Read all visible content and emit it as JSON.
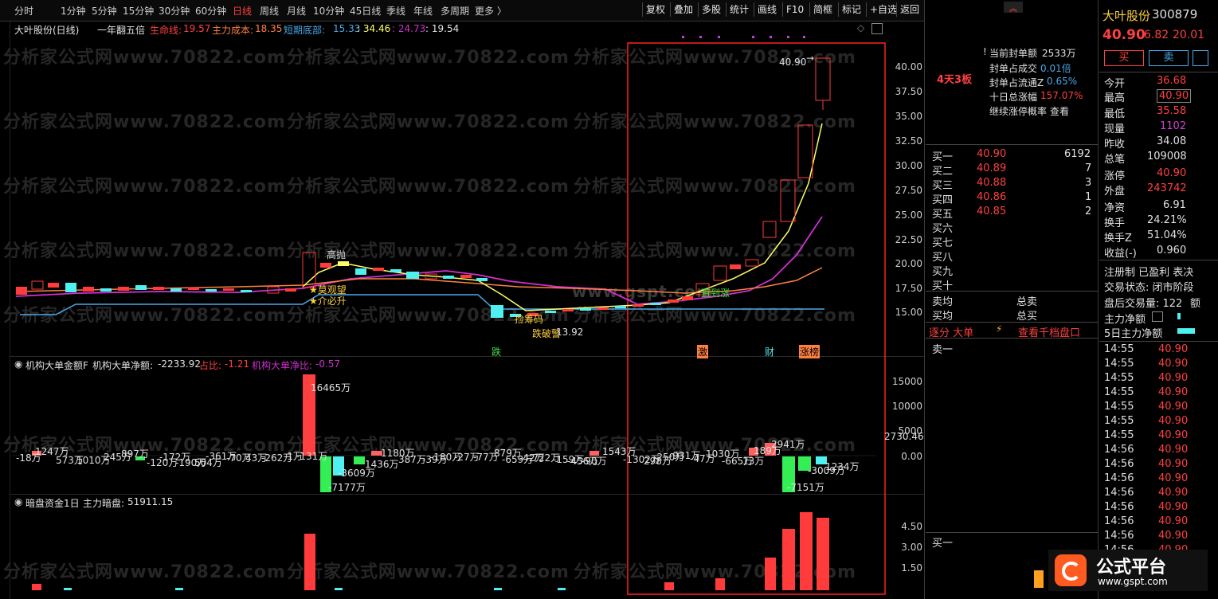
{
  "toolbar": {
    "periods": [
      "分时",
      "1分钟",
      "5分钟",
      "15分钟",
      "30分钟",
      "60分钟",
      "日线",
      "周线",
      "月线",
      "10分钟",
      "45日线",
      "季线",
      "年线",
      "多周期",
      "更多 〉"
    ],
    "active_period": "日线",
    "tools": [
      "复权",
      "叠加",
      "多股",
      "统计",
      "画线",
      "F10",
      "简框",
      "标记",
      "+自选",
      "返回"
    ]
  },
  "main_chart": {
    "stock_title": "大叶股份(日线)",
    "formula": "一年翻五倍",
    "line1_label": "生命线:",
    "line1_value": "19.57",
    "line2_label": "主力成本:",
    "line2_value": "18.35",
    "line3_label": "短期底部:",
    "line3_value": "15.33",
    "extra1": ": 34.46",
    "extra2": ": 24.73",
    "extra3": ": 19.54",
    "price_ticks": [
      "40.00",
      "37.50",
      "35.00",
      "32.50",
      "30.00",
      "27.50",
      "25.00",
      "22.50",
      "20.00",
      "17.50",
      "15.00"
    ],
    "max_label": "40.90",
    "min_label": "13.92",
    "annotations": {
      "gaopao": "高抛",
      "mohuwang": "★莫观望",
      "jiedisheng": "★介必升",
      "jiandi": "捡筹码",
      "diekan": "跌破警",
      "fanzhang": "直到涨"
    },
    "bottom_marks": {
      "die": "跌",
      "ji": "激",
      "cai": "财",
      "zhangting": "涨榜"
    },
    "colors": {
      "up": "#ff3b3b",
      "down": "#4ef0f0",
      "yellow": "#ffff66",
      "magenta": "#d030d0",
      "orange": "#ff8040",
      "blue": "#4aa8e8"
    }
  },
  "mid_chart": {
    "title": "机构大单金额F",
    "net_label": "机构大单净额:",
    "net_value": "-2233.92",
    "ratio_label": "占比:",
    "ratio_value": "-1.21",
    "net_ratio_label": "机构大单净比:",
    "net_ratio_value": "-0.57",
    "ticks": [
      "15000",
      "10000",
      "5000",
      "0.00"
    ],
    "side_value": "2730.46",
    "labels": {
      "big_up": "16465万",
      "a": "-18万",
      "b": "1247万",
      "c": "573万",
      "d": "1010万",
      "e": "245万",
      "f": "897万",
      "g": "-120万",
      "h": "-172万",
      "i": "-190万",
      "j": "504万",
      "k": "-361万",
      "l": "-70万",
      "m": "43万",
      "n": "-262万",
      "o": "-1万",
      "p": "-131万",
      "q": "-7177万",
      "r": "-3609万",
      "s": "1436万",
      "t": "1180万",
      "u": "387万",
      "v": "-39万",
      "w": "-180万",
      "x": "-27万",
      "y": "-77万",
      "z": "879万",
      "aa": "-659万",
      "bb": "-42万",
      "cc": "-722万",
      "dd": "-159万",
      "ee": "-456万",
      "ff": "-90万",
      "gg": "1543万",
      "hh": "-1302万",
      "ii": "298万",
      "jj": "-250万",
      "kk": "-931万",
      "ll": "-47万",
      "mm": "1030万",
      "nn": "-665万",
      "oo": "13万",
      "pp": "189万",
      "qq": "2941万",
      "rr": "-7151万",
      "ss": "-3009万",
      "tt": "1234万"
    }
  },
  "bottom_chart": {
    "title": "暗盘资金1日",
    "label": "主力暗盘:",
    "value": "51911.15",
    "ticks": [
      "4.50",
      "3.00",
      "1.50"
    ]
  },
  "watermark": "分析家公式网www.70822.com",
  "watermark_center": "www.gspt.com",
  "right_panel": {
    "stock_name": "大叶股份",
    "stock_code": "300879",
    "price": "40.90",
    "change": "6.82",
    "change_pct": "20.01",
    "buy_button": "买",
    "sell_button": "卖",
    "board_tag": "4天3板",
    "seal_info": [
      {
        "label": "当前封单额",
        "value": "2533万"
      },
      {
        "label": "封单占成交",
        "value": "0.01倍"
      },
      {
        "label": "封单占流通Z",
        "value": "0.65%"
      },
      {
        "label": "十日总涨幅",
        "value": "157.07%"
      },
      {
        "label": "继续涨停概率",
        "value": "查看"
      }
    ],
    "order_book": [
      {
        "label": "买一",
        "price": "40.90",
        "vol": "6192"
      },
      {
        "label": "买二",
        "price": "40.89",
        "vol": "7"
      },
      {
        "label": "买三",
        "price": "40.88",
        "vol": "3"
      },
      {
        "label": "买四",
        "price": "40.86",
        "vol": "1"
      },
      {
        "label": "买五",
        "price": "40.85",
        "vol": "2"
      },
      {
        "label": "买六",
        "price": "",
        "vol": ""
      },
      {
        "label": "买七",
        "price": "",
        "vol": ""
      },
      {
        "label": "买八",
        "price": "",
        "vol": ""
      },
      {
        "label": "买九",
        "price": "",
        "vol": ""
      },
      {
        "label": "买十",
        "price": "",
        "vol": ""
      }
    ],
    "sell_avg": "卖均",
    "buy_avg": "买均",
    "total_sell": "总卖",
    "total_buy": "总买",
    "tabs": {
      "zhubi": "逐分 大单",
      "tengxun": "查看千档盘口"
    },
    "sell1": "卖一",
    "buy1": "买一",
    "quote": [
      {
        "label": "今开",
        "value": "36.68"
      },
      {
        "label": "最高",
        "value": "40.90"
      },
      {
        "label": "最低",
        "value": "35.58"
      },
      {
        "label": "现量",
        "value": "1102"
      },
      {
        "label": "昨收",
        "value": "34.08"
      },
      {
        "label": "总笔",
        "value": "109008"
      },
      {
        "label": "涨停",
        "value": "40.90"
      },
      {
        "label": "外盘",
        "value": "243742"
      },
      {
        "label": "净资",
        "value": "6.91"
      },
      {
        "label": "换手",
        "value": "24.21%"
      },
      {
        "label": "换手Z",
        "value": "51.04%"
      },
      {
        "label": "收益(-)",
        "value": "0.960"
      }
    ],
    "registration": "注册制 已盈利 表决",
    "trade_state": "交易状态: 闭市阶段",
    "after_vol": "盘后交易量: 122",
    "after_vol_suffix": "额",
    "net_main": "主力净额",
    "net_main_5d": "5日主力净额",
    "ticks": [
      {
        "time": "14:55",
        "price": "40.90"
      },
      {
        "time": "14:55",
        "price": "40.90"
      },
      {
        "time": "14:55",
        "price": "40.90"
      },
      {
        "time": "14:55",
        "price": "40.90"
      },
      {
        "time": "14:55",
        "price": "40.90"
      },
      {
        "time": "14:55",
        "price": "40.90"
      },
      {
        "time": "14:55",
        "price": "40.90"
      },
      {
        "time": "14:56",
        "price": "40.90"
      },
      {
        "time": "14:56",
        "price": "40.90"
      },
      {
        "time": "14:56",
        "price": "40.90"
      },
      {
        "time": "14:56",
        "price": "40.90"
      },
      {
        "time": "14:56",
        "price": "40.90"
      },
      {
        "time": "14:56",
        "price": "40.90"
      },
      {
        "time": "14:56",
        "price": "40.90"
      },
      {
        "time": "14:56",
        "price": "40.90"
      }
    ]
  },
  "logo": {
    "text": "公式平台",
    "url": "www.gspt.com"
  }
}
